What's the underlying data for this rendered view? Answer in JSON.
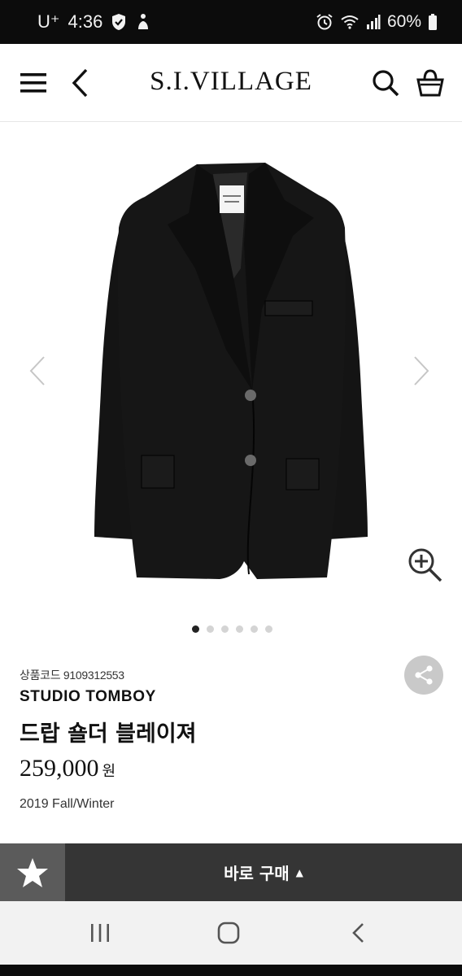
{
  "status_bar": {
    "carrier": "U⁺",
    "time": "4:36",
    "battery": "60%",
    "icons": [
      "shield-check-icon",
      "accessibility-icon",
      "alarm-icon",
      "wifi-icon",
      "signal-icon",
      "battery-icon"
    ]
  },
  "header": {
    "brand": "S.I.VILLAGE",
    "icons": [
      "menu-icon",
      "back-icon",
      "search-icon",
      "basket-icon"
    ]
  },
  "carousel": {
    "total": 6,
    "active_index": 0
  },
  "product": {
    "code": "상품코드 9109312553",
    "brand": "STUDIO TOMBOY",
    "name": "드랍 숄더 블레이져",
    "price": "259,000",
    "currency": "원",
    "season": "2019 Fall/Winter",
    "jacket_color": "#111111"
  },
  "action_bar": {
    "buy_label": "바로 구매",
    "wish_icon": "star-icon",
    "accent_dark": "#353535",
    "accent_wish": "#5b5b5b"
  },
  "nav_bar": {
    "icons": [
      "recent-apps-icon",
      "home-icon",
      "back-nav-icon"
    ]
  }
}
